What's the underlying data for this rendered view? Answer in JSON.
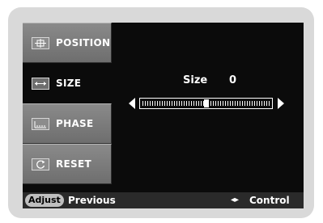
{
  "menu": {
    "items": [
      {
        "label": "POSITION",
        "icon": "position-icon",
        "selected": false
      },
      {
        "label": "SIZE",
        "icon": "size-icon",
        "selected": true
      },
      {
        "label": "PHASE",
        "icon": "phase-icon",
        "selected": false
      },
      {
        "label": "RESET",
        "icon": "reset-icon",
        "selected": false
      }
    ]
  },
  "panel": {
    "title": "Size",
    "value": "0",
    "slider_fraction": 0.5
  },
  "footer": {
    "adjust_label": "Adjust",
    "previous_label": "Previous",
    "control_icon": "left-right-arrows-icon",
    "control_label": "Control"
  }
}
